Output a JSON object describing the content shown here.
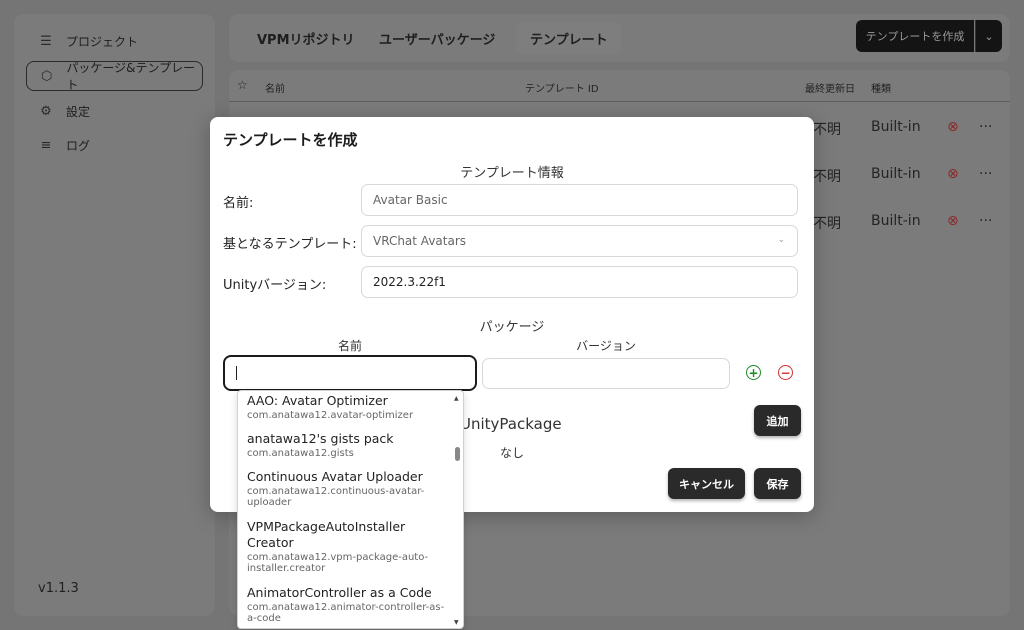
{
  "sidebar": {
    "items": [
      {
        "icon": "list-icon",
        "label": "プロジェクト"
      },
      {
        "icon": "package-icon",
        "label": "パッケージ&テンプレート"
      },
      {
        "icon": "gear-icon",
        "label": "設定"
      },
      {
        "icon": "log-icon",
        "label": "ログ"
      }
    ],
    "version": "v1.1.3"
  },
  "tabs": [
    "VPMリポジトリ",
    "ユーザーパッケージ",
    "テンプレート"
  ],
  "create_button": "テンプレートを作成",
  "table": {
    "headers": {
      "star": "☆",
      "name": "名前",
      "template_id": "テンプレート ID",
      "updated": "最終更新日",
      "kind": "種類"
    },
    "rows": [
      {
        "updated": "不明",
        "kind": "Built-in"
      },
      {
        "updated": "不明",
        "kind": "Built-in"
      },
      {
        "updated": "不明",
        "kind": "Built-in"
      }
    ]
  },
  "modal": {
    "title": "テンプレートを作成",
    "info_section": "テンプレート情報",
    "name_label": "名前:",
    "name_placeholder": "Avatar Basic",
    "base_label": "基となるテンプレート:",
    "base_value": "VRChat Avatars",
    "unity_label": "Unityバージョン:",
    "unity_value": "2022.3.22f1",
    "packages_section": "パッケージ",
    "col_name": "名前",
    "col_version": "バージョン",
    "unitypackage_section": "UnityPackage",
    "unitypackage_none": "なし",
    "add_button": "追加",
    "cancel_button": "キャンセル",
    "save_button": "保存"
  },
  "suggestions": [
    {
      "name": "AAO: Avatar Optimizer",
      "id": "com.anatawa12.avatar-optimizer"
    },
    {
      "name": "anatawa12's gists pack",
      "id": "com.anatawa12.gists"
    },
    {
      "name": "Continuous Avatar Uploader",
      "id": "com.anatawa12.continuous-avatar-uploader"
    },
    {
      "name": "VPMPackageAutoInstaller Creator",
      "id": "com.anatawa12.vpm-package-auto-installer.creator"
    },
    {
      "name": "AnimatorController as a Code",
      "id": "com.anatawa12.animator-controller-as-a-code"
    }
  ]
}
